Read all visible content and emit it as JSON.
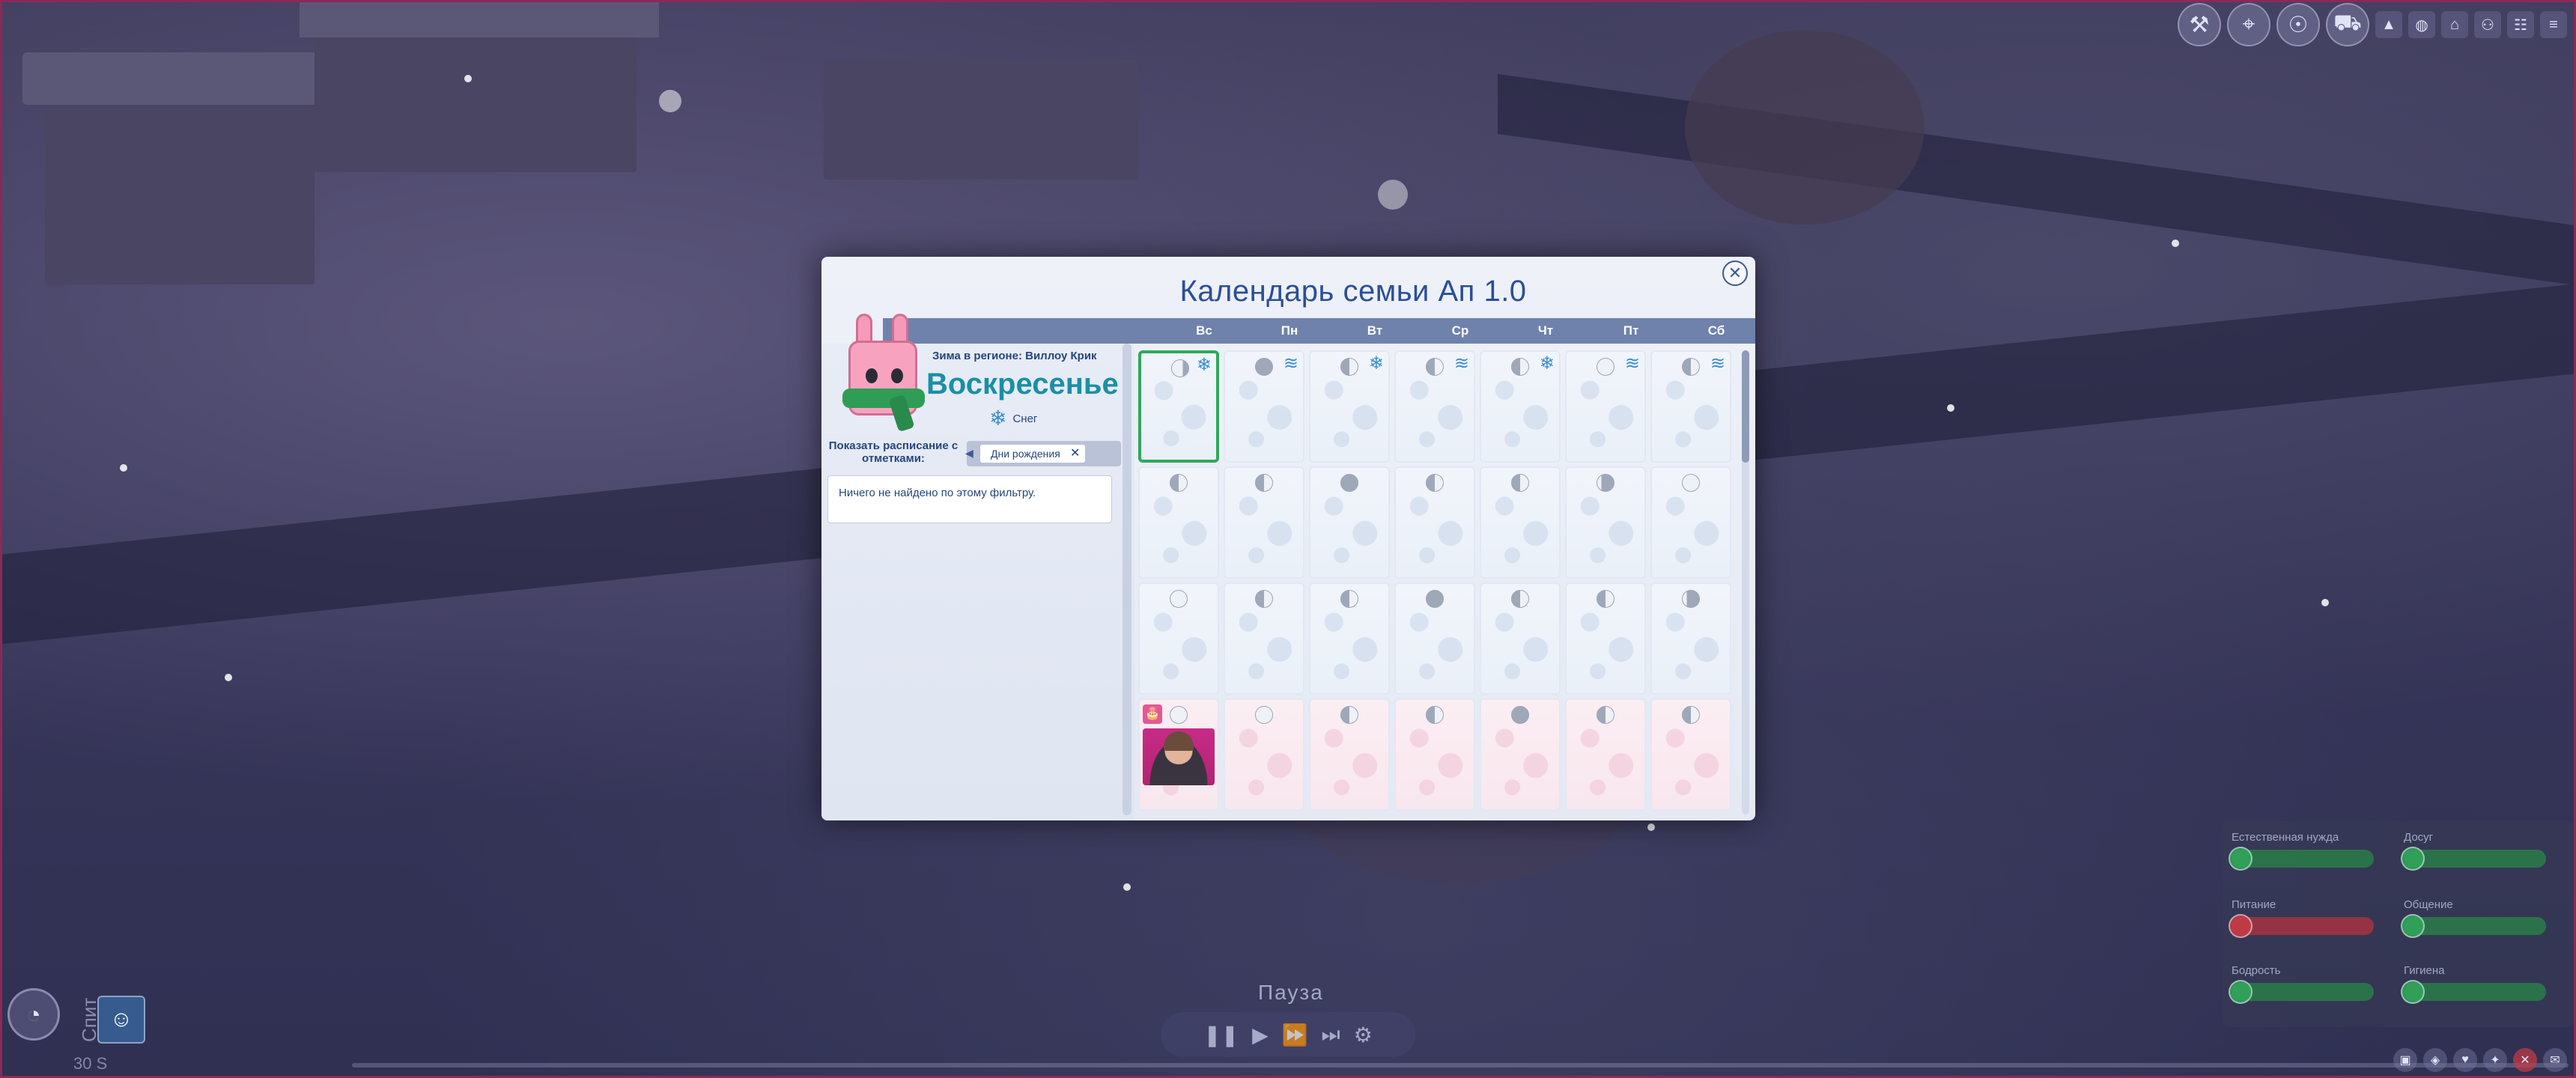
{
  "modal": {
    "title": "Календарь семьи Ап 1.0",
    "close_glyph": "✕",
    "weekdays": [
      "Вс",
      "Пн",
      "Вт",
      "Ср",
      "Чт",
      "Пт",
      "Сб"
    ],
    "left": {
      "region": "Зима в регионе: Виллоу Крик",
      "day_name": "Воскресенье",
      "weather_icon": "snow-icon",
      "weather_glyph": "❄",
      "weather_label": "Снег",
      "filter_label": "Показать расписание с отметками:",
      "filter_chip": "Дни рождения",
      "filter_chip_remove": "✕",
      "filter_arrow": "◀",
      "empty_result": "Ничего не найдено по этому фильтру."
    },
    "weather_row1": [
      "snow-icon",
      "wind-icon",
      "snow-icon",
      "wind-icon",
      "snow-icon",
      "wind-icon",
      "wind-icon"
    ],
    "weather_glyphs": {
      "snow-icon": "❄",
      "wind-icon": "≋"
    },
    "moon_rows": [
      [
        "cres",
        "full",
        "halfl",
        "halfl",
        "halfl",
        "new",
        "halfl"
      ],
      [
        "halfl",
        "halfl",
        "full",
        "halfl",
        "halfl",
        "gib",
        "new"
      ],
      [
        "new",
        "halfl",
        "halfl",
        "full",
        "halfl",
        "halfl",
        "gib"
      ],
      [
        "new",
        "new",
        "halfl",
        "halfl",
        "full",
        "halfl",
        "halfl"
      ]
    ],
    "birthday": {
      "icon": "cake-icon",
      "glyph": "🎂"
    }
  },
  "hud": {
    "pause_label": "Пауза",
    "sleep_label": "Спит",
    "time_readout": "30 S",
    "needs": [
      {
        "label": "Естественная нужда",
        "state": "ok"
      },
      {
        "label": "Досуг",
        "state": "ok"
      },
      {
        "label": "Питание",
        "state": "low"
      },
      {
        "label": "Общение",
        "state": "ok"
      },
      {
        "label": "Бодрость",
        "state": "ok"
      },
      {
        "label": "Гигиена",
        "state": "ok"
      }
    ]
  },
  "colors": {
    "title": "#2a4f96",
    "day_name": "#1b8fa5",
    "today_border": "#2fa85a",
    "weekday_bar": "#6f82ac",
    "frame_border": "#8a2a55"
  }
}
